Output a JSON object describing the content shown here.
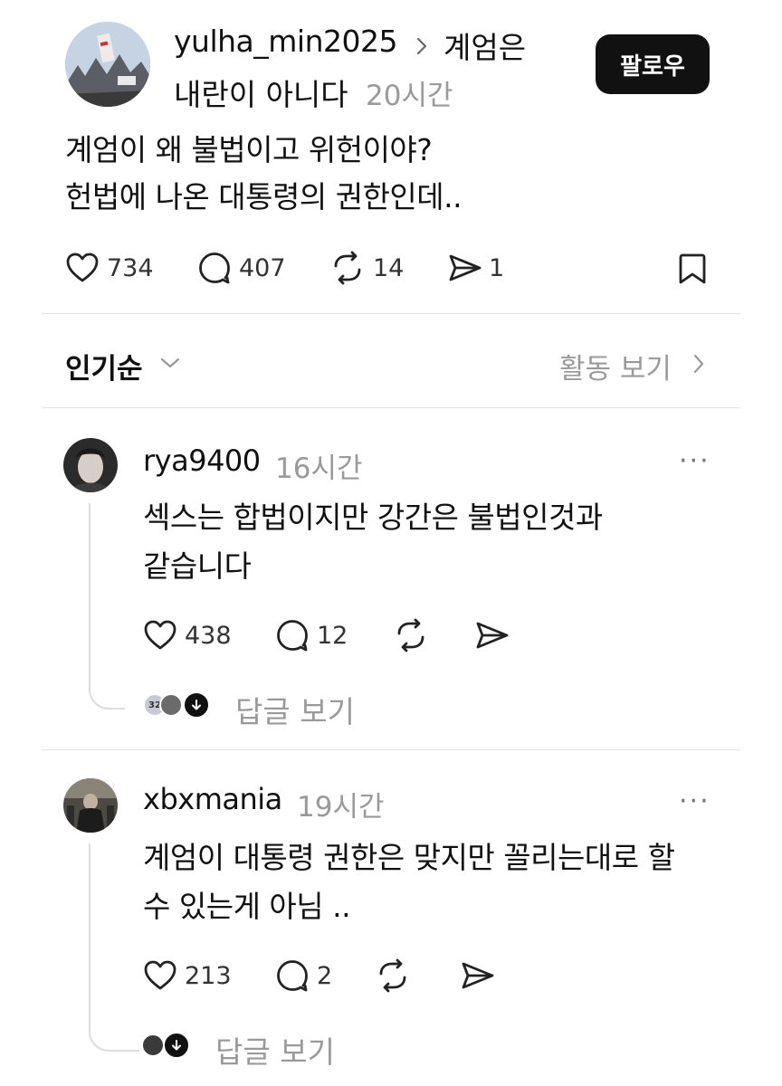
{
  "post": {
    "username": "yulha_min2025",
    "topic_line1": "계엄은",
    "topic_line2": "내란이 아니다",
    "time": "20시간",
    "follow_label": "팔로우",
    "text_line1": "계엄이 왜 불법이고 위헌이야?",
    "text_line2": "헌법에 나온 대통령의 권한인데..",
    "likes": "734",
    "comments": "407",
    "reposts": "14",
    "shares": "1"
  },
  "sort": {
    "label": "인기순",
    "activity_label": "활동 보기"
  },
  "comments": [
    {
      "username": "rya9400",
      "time": "16시간",
      "text_line1": "섹스는 합법이지만 강간은 불법인것과",
      "text_line2": "같습니다",
      "likes": "438",
      "replies": "12",
      "more": "···",
      "view_replies": "답글 보기",
      "mini_avatar_text": "32"
    },
    {
      "username": "xbxmania",
      "time": "19시간",
      "text_line1": "계엄이 대통령 권한은 맞지만 꼴리는대로 할",
      "text_line2": "수 있는게 아님 ..",
      "likes": "213",
      "replies": "2",
      "more": "···",
      "view_replies": "답글 보기"
    }
  ],
  "icons": {
    "heart": "heart-icon",
    "comment": "comment-icon",
    "repost": "repost-icon",
    "share": "share-icon",
    "bookmark": "bookmark-icon",
    "chevron_down": "chevron-down-icon",
    "chevron_right": "chevron-right-icon",
    "more": "more-icon"
  },
  "colors": {
    "text": "#111111",
    "muted": "#9a9a9a",
    "divider": "#e4e4e4",
    "follow_bg": "#111111"
  }
}
